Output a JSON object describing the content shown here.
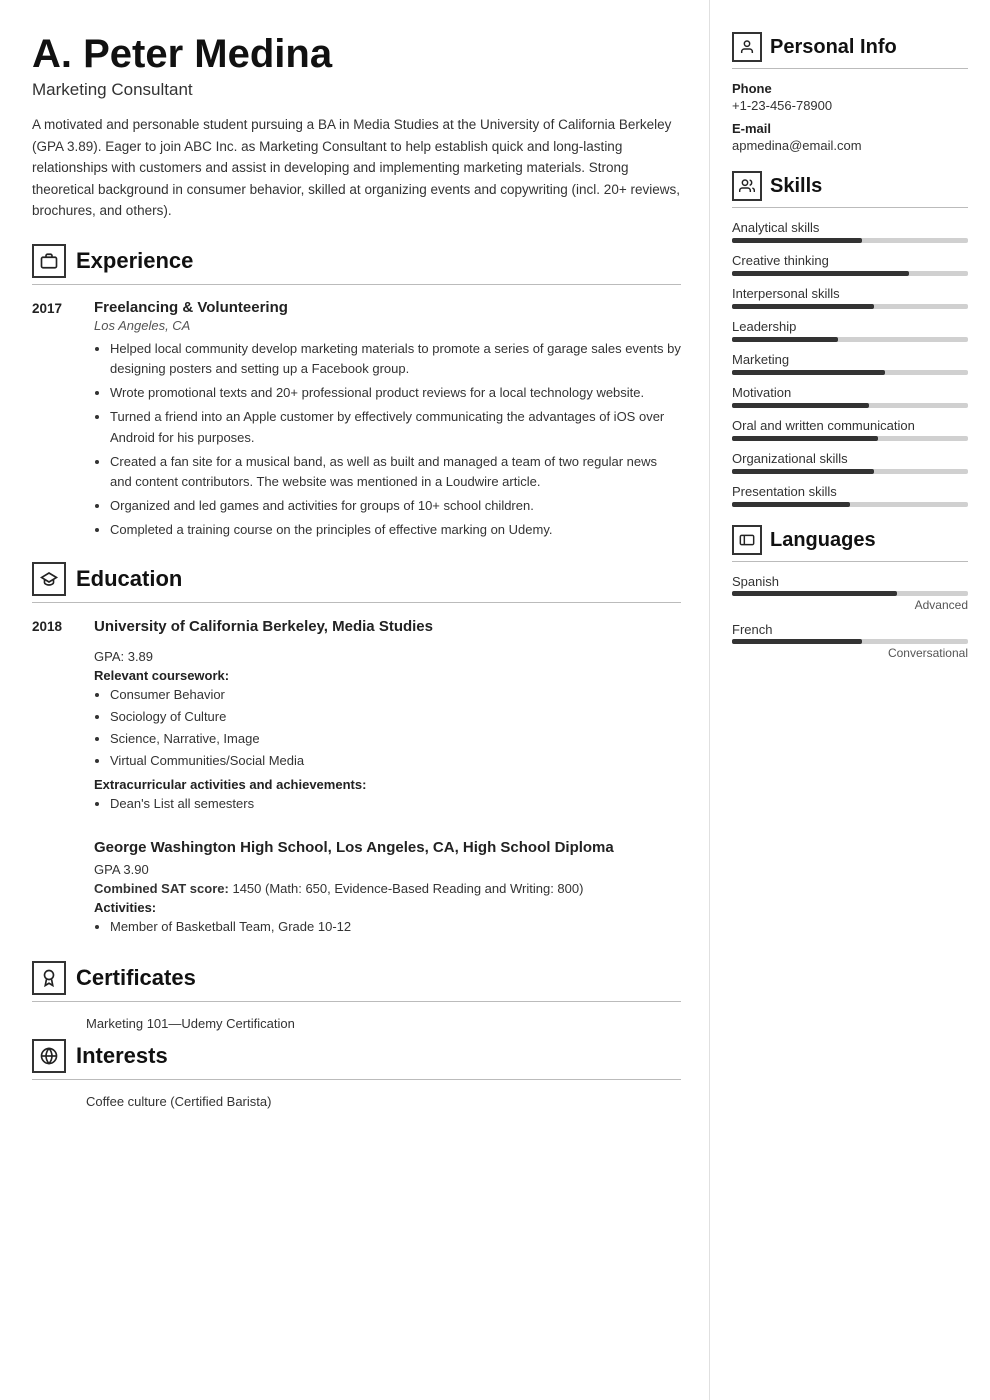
{
  "header": {
    "name": "A. Peter Medina",
    "job_title": "Marketing Consultant",
    "summary": "A motivated and personable student pursuing a BA in Media Studies at the University of California Berkeley (GPA 3.89). Eager to join ABC Inc. as Marketing Consultant to help establish quick and long-lasting relationships with customers and assist in developing and implementing marketing materials. Strong theoretical background in consumer behavior, skilled at organizing events and copywriting (incl. 20+ reviews, brochures, and others)."
  },
  "sections": {
    "experience_title": "Experience",
    "education_title": "Education",
    "certificates_title": "Certificates",
    "interests_title": "Interests",
    "personal_info_title": "Personal Info",
    "skills_title": "Skills",
    "languages_title": "Languages"
  },
  "experience": [
    {
      "year": "2017",
      "job_title": "Freelancing & Volunteering",
      "location": "Los Angeles, CA",
      "bullets": [
        "Helped local community develop marketing materials to promote a series of garage sales events by designing posters and setting up a Facebook group.",
        "Wrote promotional texts and 20+ professional product reviews for a local technology website.",
        "Turned a friend into an Apple customer by effectively communicating the advantages of iOS over Android for his purposes.",
        "Created a fan site for a musical band, as well as built and managed a team of two regular news and content contributors. The website was mentioned in a Loudwire article.",
        "Organized and led games and activities for groups of 10+ school children.",
        "Completed a training course on the principles of effective marking on Udemy."
      ]
    }
  ],
  "education": [
    {
      "year": "2018",
      "school": "University of California Berkeley, Media Studies",
      "gpa": "GPA: 3.89",
      "coursework_label": "Relevant coursework:",
      "coursework": [
        "Consumer Behavior",
        "Sociology of Culture",
        "Science, Narrative, Image",
        "Virtual Communities/Social Media"
      ],
      "extracurricular_label": "Extracurricular activities and achievements:",
      "extracurricular": [
        "Dean's List all semesters"
      ]
    },
    {
      "year": "",
      "school": "George Washington High School, Los Angeles, CA, High School Diploma",
      "gpa": "GPA 3.90",
      "sat_label": "Combined SAT score:",
      "sat_value": "1450 (Math: 650, Evidence-Based Reading and Writing: 800)",
      "activities_label": "Activities:",
      "activities": [
        "Member of Basketball Team, Grade 10-12"
      ]
    }
  ],
  "certificates": [
    "Marketing 101—Udemy Certification"
  ],
  "interests": [
    "Coffee culture (Certified Barista)"
  ],
  "personal_info": {
    "phone_label": "Phone",
    "phone_value": "+1-23-456-78900",
    "email_label": "E-mail",
    "email_value": "apmedina@email.com"
  },
  "skills": [
    {
      "name": "Analytical skills",
      "percent": 55
    },
    {
      "name": "Creative thinking",
      "percent": 75
    },
    {
      "name": "Interpersonal skills",
      "percent": 60
    },
    {
      "name": "Leadership",
      "percent": 45
    },
    {
      "name": "Marketing",
      "percent": 65
    },
    {
      "name": "Motivation",
      "percent": 58
    },
    {
      "name": "Oral and written communication",
      "percent": 62
    },
    {
      "name": "Organizational skills",
      "percent": 60
    },
    {
      "name": "Presentation skills",
      "percent": 50
    }
  ],
  "languages": [
    {
      "name": "Spanish",
      "percent": 70,
      "level": "Advanced"
    },
    {
      "name": "French",
      "percent": 55,
      "level": "Conversational"
    }
  ],
  "icons": {
    "experience": "💼",
    "education": "🎓",
    "certificates": "🏅",
    "interests": "🌐",
    "personal_info": "👤",
    "skills": "🤝",
    "languages": "🚩"
  }
}
